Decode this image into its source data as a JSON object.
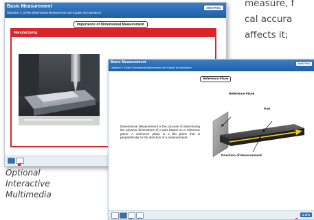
{
  "background_text": {
    "lines": [
      "measure, f",
      "cal accura",
      "affects it;"
    ]
  },
  "caption": {
    "lines": [
      "Optional",
      "Interactive",
      "Multimedia"
    ]
  },
  "back_window": {
    "app_title": "Basic Measurement",
    "subtitle": "Objective 1: Define Dimensional Measurement and Explain Its Importance",
    "logo": "AMATROL",
    "section_title": "Importance of Dimensional Measurement",
    "panel_title": "Manufacturing"
  },
  "front_window": {
    "app_title": "Basic Measurement",
    "subtitle": "Objective 1: Define Dimensional Measurement and Explain Its Importance",
    "logo": "AMATROL",
    "section_title": "Reference Plane",
    "body_text": "Dimensional Measurement is the process of determining the physical dimensions of a part based on a reference plane. A reference plane is a flat plane that is perpendicular to the direction of a measurement.",
    "diagram_labels": {
      "reference_plane": "Reference Plane",
      "part": "Part",
      "direction": "Direction of Measurement"
    },
    "page_indicator": "2 of 5"
  },
  "colors": {
    "header_blue": "#2a6db5",
    "accent_red": "#d9242a",
    "arrow_yellow": "#f2d20c"
  }
}
